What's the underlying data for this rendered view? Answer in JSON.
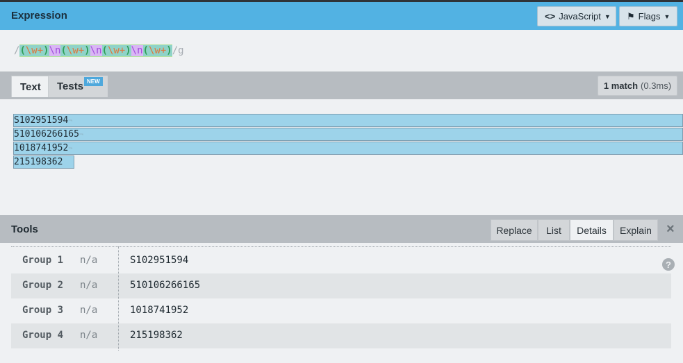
{
  "expression": {
    "title": "Expression",
    "flavor_button": "JavaScript",
    "flags_button": "Flags",
    "delim_open": "/",
    "delim_close": "/g",
    "group_token": "\\w+",
    "newline_token": "\\n"
  },
  "text_panel": {
    "tabs": [
      {
        "label": "Text"
      },
      {
        "label": "Tests",
        "badge": "NEW"
      }
    ],
    "match_count": "1 match",
    "match_time": "(0.3ms)",
    "lines": [
      "S102951594",
      "510106266165",
      "1018741952",
      "215198362"
    ],
    "newline_marker": "¬"
  },
  "tools": {
    "title": "Tools",
    "tabs": [
      "Replace",
      "List",
      "Details",
      "Explain"
    ],
    "active_tab": "Details",
    "close_icon": "×",
    "help_icon": "?",
    "groups": [
      {
        "name": "Group 1",
        "range": "n/a",
        "value": "S102951594"
      },
      {
        "name": "Group 2",
        "range": "n/a",
        "value": "510106266165"
      },
      {
        "name": "Group 3",
        "range": "n/a",
        "value": "1018741952"
      },
      {
        "name": "Group 4",
        "range": "n/a",
        "value": "215198362"
      }
    ]
  },
  "colors": {
    "header_blue": "#52b2e3",
    "match_highlight": "#9dd3ea",
    "group_paren": "#2f9f57",
    "token_orange": "#e0753b",
    "newline_purple": "#a24fdc"
  }
}
